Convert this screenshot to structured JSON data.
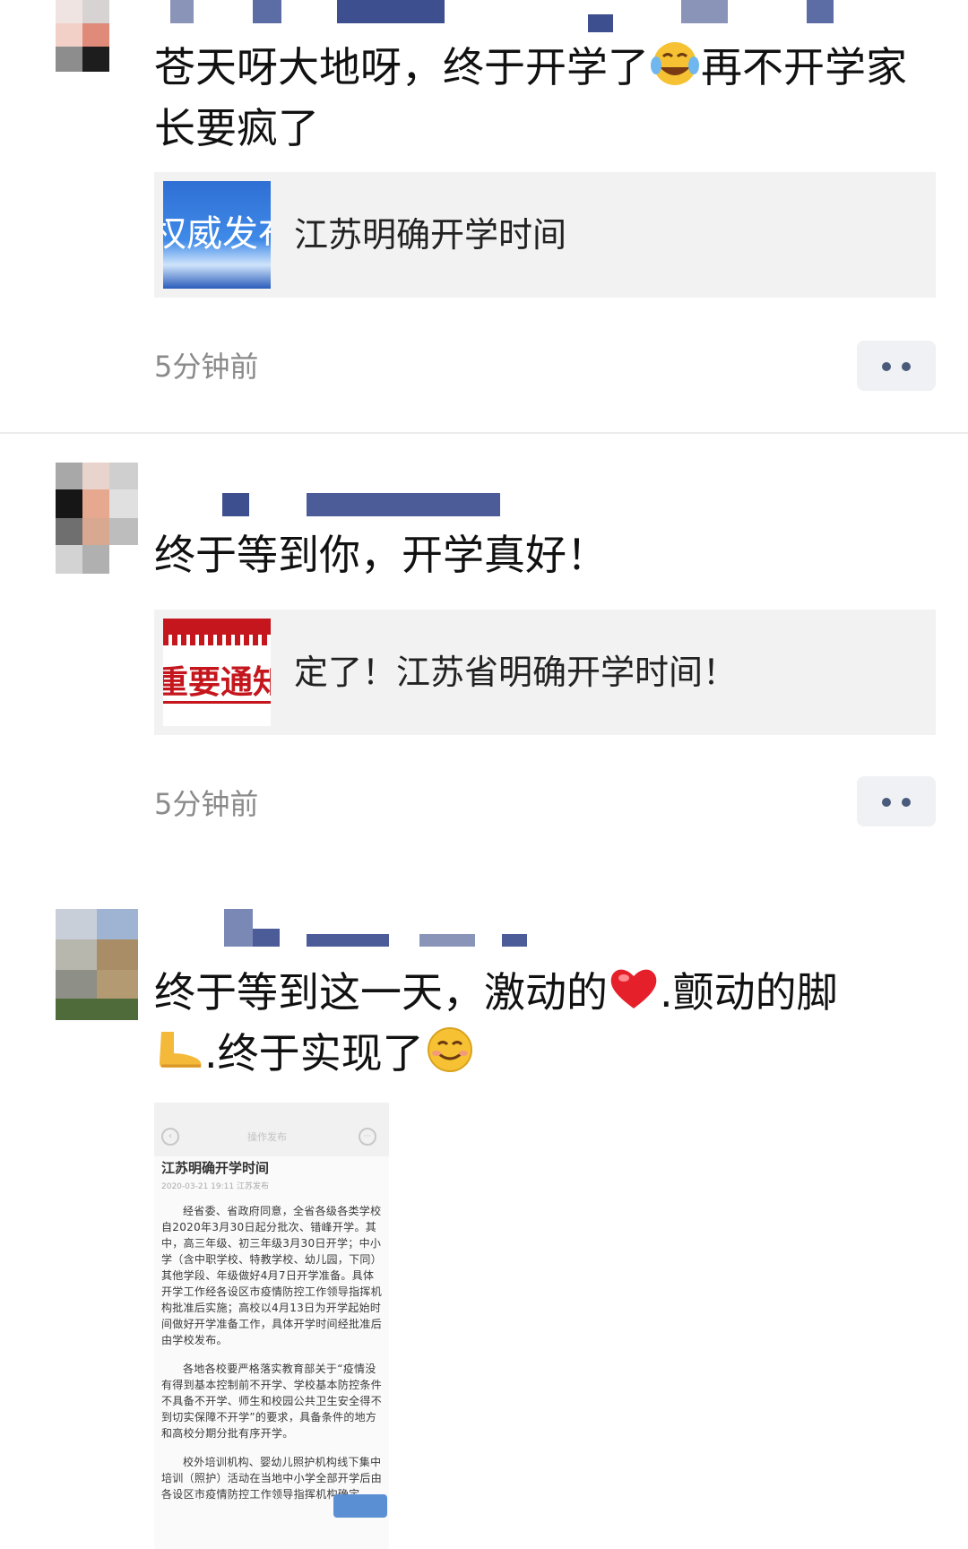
{
  "posts": [
    {
      "text": "苍天呀大地呀，终于开学了",
      "text_after_emoji": "再不开学家长要疯了",
      "emoji": "tears-of-joy-emoji",
      "link": {
        "thumb_text": "权威发布",
        "title": "江苏明确开学时间"
      },
      "time": "5分钟前"
    },
    {
      "text": "终于等到你，开学真好！",
      "link": {
        "thumb_text": "重要通知",
        "title": "定了！江苏省明确开学时间！"
      },
      "time": "5分钟前"
    },
    {
      "text_part1": "终于等到这一天，激动的",
      "text_part2": ".颤动的脚",
      "text_part3": ".终于实现了",
      "emoji": [
        "red-heart-emoji",
        "foot-emoji",
        "smiling-face-emoji"
      ],
      "news": {
        "header": "操作发布",
        "title": "江苏明确开学时间",
        "date": "2020-03-21 19:11 江苏发布",
        "paragraphs": [
          "经省委、省政府同意，全省各级各类学校自2020年3月30日起分批次、错峰开学。其中，高三年级、初三年级3月30日开学；中小学（含中职学校、特教学校、幼儿园，下同）其他学段、年级做好4月7日开学准备。具体开学工作经各设区市疫情防控工作领导指挥机构批准后实施；高校以4月13日为开学起始时间做好开学准备工作，具体开学时间经批准后由学校发布。",
          "各地各校要严格落实教育部关于“疫情没有得到基本控制前不开学、学校基本防控条件不具备不开学、师生和校园公共卫生安全得不到切实保障不开学”的要求，具备条件的地方和高校分期分批有序开学。",
          "校外培训机构、婴幼儿照护机构线下集中培训（照护）活动在当地中小学全部开学后由各设区市疫情防控工作领导指挥机构确定。"
        ]
      }
    }
  ],
  "colors": {
    "bg": "#ffffff",
    "card": "#f2f2f2",
    "time": "#8a8a8a",
    "more_dot": "#4a5a7a"
  }
}
